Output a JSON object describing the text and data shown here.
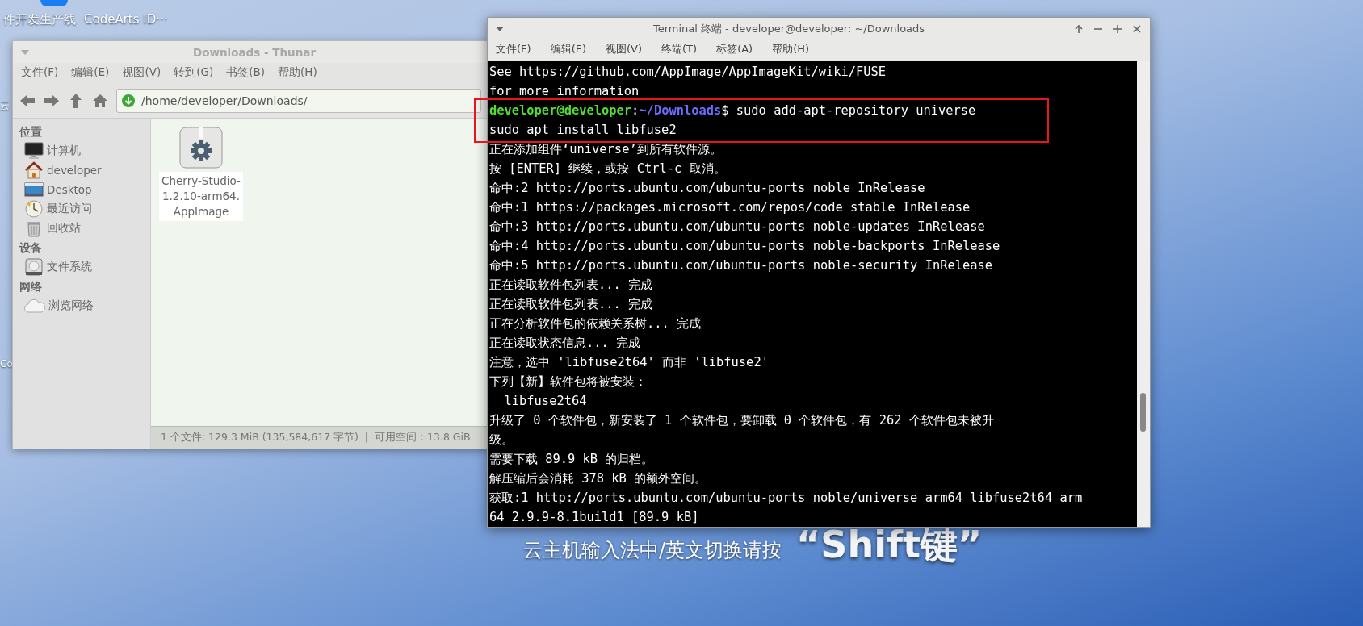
{
  "desktop": {
    "icons": [
      {
        "label": "件开发生产线",
        "kind": "app"
      },
      {
        "label": "CodeArts ID···",
        "kind": "none"
      }
    ],
    "side_fragments": [
      "云",
      "Co"
    ],
    "overlay_hint": {
      "text": "云主机输入法中/英文切换请按",
      "key": "“Shift键”"
    }
  },
  "file_manager": {
    "title": "Downloads - Thunar",
    "menu": [
      "文件(F)",
      "编辑(E)",
      "视图(V)",
      "转到(G)",
      "书签(B)",
      "帮助(H)"
    ],
    "location": "/home/developer/Downloads/",
    "sidebar": [
      {
        "title": "位置",
        "items": [
          {
            "label": "计算机",
            "kind": "computer"
          },
          {
            "label": "developer",
            "kind": "home"
          },
          {
            "label": "Desktop",
            "kind": "desktop"
          },
          {
            "label": "最近访问",
            "kind": "recent"
          },
          {
            "label": "回收站",
            "kind": "trash"
          }
        ]
      },
      {
        "title": "设备",
        "items": [
          {
            "label": "文件系统",
            "kind": "drive"
          }
        ]
      },
      {
        "title": "网络",
        "items": [
          {
            "label": "浏览网络",
            "kind": "network"
          }
        ]
      }
    ],
    "files": [
      {
        "name": "Cherry-Studio-1.2.10-arm64.AppImage",
        "selected": true
      }
    ],
    "status": "1 个文件: 129.3 MiB (135,584,617 字节)  |  可用空间：13.8 GiB"
  },
  "terminal": {
    "title": "Terminal 终端 - developer@developer: ~/Downloads",
    "menu": [
      "文件(F)",
      "编辑(E)",
      "视图(V)",
      "终端(T)",
      "标签(A)",
      "帮助(H)"
    ],
    "lines": [
      {
        "kind": "text",
        "text": "See https://github.com/AppImage/AppImageKit/wiki/FUSE"
      },
      {
        "kind": "text",
        "text": "for more information"
      },
      {
        "kind": "prompt",
        "user": "developer@developer",
        "separator": ":",
        "path": "~/Downloads",
        "command": "$ sudo add-apt-repository universe"
      },
      {
        "kind": "text",
        "text": "sudo apt install libfuse2"
      },
      {
        "kind": "text",
        "text": "正在添加组件‘universe’到所有软件源。"
      },
      {
        "kind": "text",
        "text": "按 [ENTER] 继续，或按 Ctrl-c 取消。"
      },
      {
        "kind": "text",
        "text": "命中:2 http://ports.ubuntu.com/ubuntu-ports noble InRelease"
      },
      {
        "kind": "text",
        "text": "命中:1 https://packages.microsoft.com/repos/code stable InRelease"
      },
      {
        "kind": "text",
        "text": "命中:3 http://ports.ubuntu.com/ubuntu-ports noble-updates InRelease"
      },
      {
        "kind": "text",
        "text": "命中:4 http://ports.ubuntu.com/ubuntu-ports noble-backports InRelease"
      },
      {
        "kind": "text",
        "text": "命中:5 http://ports.ubuntu.com/ubuntu-ports noble-security InRelease"
      },
      {
        "kind": "text",
        "text": "正在读取软件包列表... 完成"
      },
      {
        "kind": "text",
        "text": "正在读取软件包列表... 完成"
      },
      {
        "kind": "text",
        "text": "正在分析软件包的依赖关系树... 完成"
      },
      {
        "kind": "text",
        "text": "正在读取状态信息... 完成"
      },
      {
        "kind": "text",
        "text": "注意，选中 'libfuse2t64' 而非 'libfuse2'"
      },
      {
        "kind": "text",
        "text": "下列【新】软件包将被安装："
      },
      {
        "kind": "text",
        "text": "  libfuse2t64"
      },
      {
        "kind": "text",
        "text": "升级了 0 个软件包，新安装了 1 个软件包，要卸载 0 个软件包，有 262 个软件包未被升"
      },
      {
        "kind": "text",
        "text": "级。"
      },
      {
        "kind": "text",
        "text": "需要下载 89.9 kB 的归档。"
      },
      {
        "kind": "text",
        "text": "解压缩后会消耗 378 kB 的额外空间。"
      },
      {
        "kind": "text",
        "text": "获取:1 http://ports.ubuntu.com/ubuntu-ports noble/universe arm64 libfuse2t64 arm"
      },
      {
        "kind": "text",
        "text": "64 2.9.9-8.1build1 [89.9 kB]"
      }
    ]
  },
  "annotation": {
    "kind": "rectangle"
  }
}
